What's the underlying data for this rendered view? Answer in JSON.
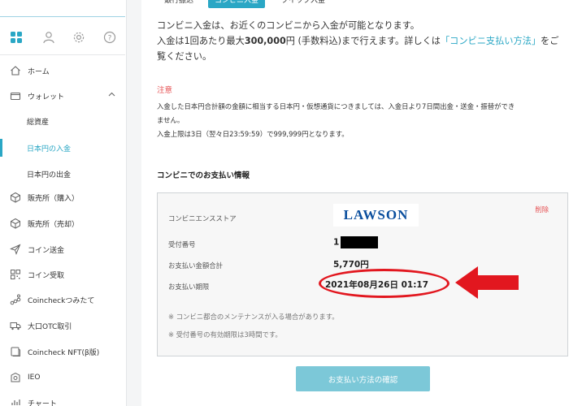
{
  "tabs": [
    "銀行振込",
    "コンビニ入金",
    "クイック入金"
  ],
  "sidebar": {
    "items": [
      {
        "label": "ホーム",
        "icon": "home-icon"
      },
      {
        "label": "ウォレット",
        "icon": "wallet-icon"
      },
      {
        "label": "販売所（購入）",
        "icon": "cube-icon"
      },
      {
        "label": "販売所（売却）",
        "icon": "cube-icon"
      },
      {
        "label": "コイン送金",
        "icon": "send-icon"
      },
      {
        "label": "コイン受取",
        "icon": "qr-icon"
      },
      {
        "label": "Coincheckつみたて",
        "icon": "coins-icon"
      },
      {
        "label": "大口OTC取引",
        "icon": "truck-icon"
      },
      {
        "label": "Coincheck NFT(β版)",
        "icon": "nft-icon"
      },
      {
        "label": "IEO",
        "icon": "ieo-icon"
      },
      {
        "label": "チャート",
        "icon": "chart-icon"
      }
    ],
    "wallet_sub": [
      "総資産",
      "日本円の入金",
      "日本円の出金"
    ],
    "accent": "#2aa7c5"
  },
  "intro": {
    "line1": "コンビニ入金は、お近くのコンビニから入金が可能となります。",
    "line2_a": "入金は1回あたり最大",
    "line2_amount": "300,000",
    "line2_b": "円 (手数料込)まで行えます。詳しくは",
    "link": "「コンビニ支払い方法」",
    "line2_c": "をご",
    "line3": "覧ください。"
  },
  "notice": {
    "title": "注意",
    "line1": "入金した日本円合計額の金額に相当する日本円・仮想通貨につきましては、入金日より7日間出金・送金・振替ができ",
    "line2": "ません。",
    "line3": "入金上限は3日（翌々日23:59:59）で999,999円となります。"
  },
  "payment_info": {
    "section_title": "コンビニでのお支払い情報",
    "store_label": "コンビニエンスストア",
    "store_logo": "LAWSON",
    "delete_label": "削除",
    "receipt_label": "受付番号",
    "receipt_value": "1",
    "amount_label": "お支払い金額合計",
    "amount_value": "5,770円",
    "deadline_label": "お支払い期限",
    "deadline_value": "2021年08月26日 01:17",
    "note1": "※ コンビニ都合のメンテナンスが入る場合があります。",
    "note2": "※ 受付番号の有効期限は3時間です。",
    "colors": {
      "danger": "#e65153",
      "highlight": "#e2171f",
      "logo": "#0b4f9e"
    }
  },
  "confirm_button": "お支払い方法の確認"
}
